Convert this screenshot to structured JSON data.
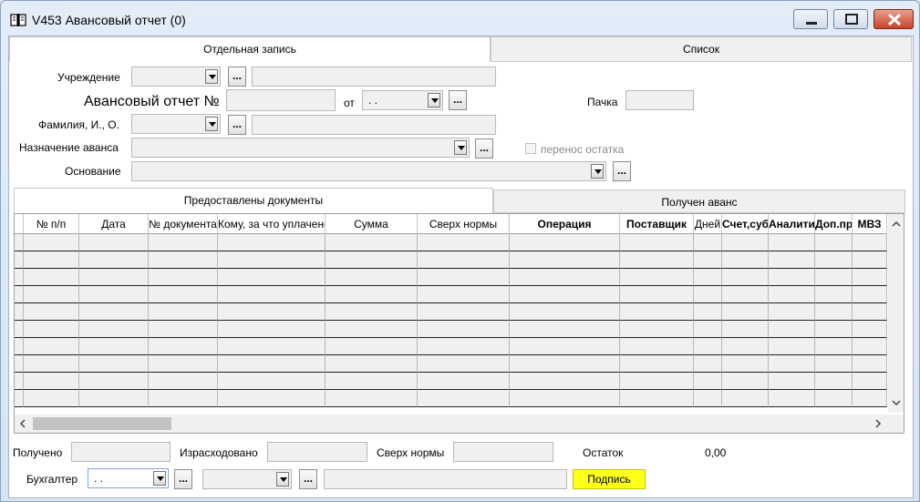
{
  "window": {
    "title": "V453 Авансовый отчет (0)"
  },
  "top_tabs": [
    {
      "label": "Отдельная запись",
      "active": true
    },
    {
      "label": "Список",
      "active": false
    }
  ],
  "form": {
    "institution_label": "Учреждение",
    "report_label": "Авансовый отчет №",
    "from_label": "от",
    "report_date": " .  .",
    "pack_label": "Пачка",
    "name_label": "Фамилия, И., О.",
    "purpose_label": "Назначение аванса",
    "carryover_label": "перенос остатка",
    "basis_label": "Основание",
    "browse_label": "..."
  },
  "inner_tabs": [
    {
      "label": "Предоставлены документы",
      "active": true
    },
    {
      "label": "Получен аванс",
      "active": false
    }
  ],
  "grid": {
    "columns": [
      {
        "label": "№ п/п",
        "bold": false
      },
      {
        "label": "Дата",
        "bold": false
      },
      {
        "label": "№ документа",
        "bold": false
      },
      {
        "label": "Кому, за что уплачено",
        "bold": false
      },
      {
        "label": "Сумма",
        "bold": false
      },
      {
        "label": "Сверх нормы",
        "bold": false
      },
      {
        "label": "Операция",
        "bold": true
      },
      {
        "label": "Поставщик",
        "bold": true
      },
      {
        "label": "Дней",
        "bold": false
      },
      {
        "label": "Счет,субсчет",
        "bold": true
      },
      {
        "label": "Аналитика",
        "bold": true
      },
      {
        "label": "Доп.признак",
        "bold": true
      },
      {
        "label": "МВЗ",
        "bold": true
      }
    ],
    "row_count": 10
  },
  "footer": {
    "received_label": "Получено",
    "spent_label": "Израсходовано",
    "over_norm_label": "Сверх нормы",
    "remainder_label": "Остаток",
    "remainder_value": "0,00",
    "accountant_label": "Бухгалтер",
    "accountant_date": " .  .",
    "sign_label": "Подпись"
  },
  "colors": {
    "sign_button": "#ffff1a",
    "field_disabled": "#f0f0f0"
  }
}
